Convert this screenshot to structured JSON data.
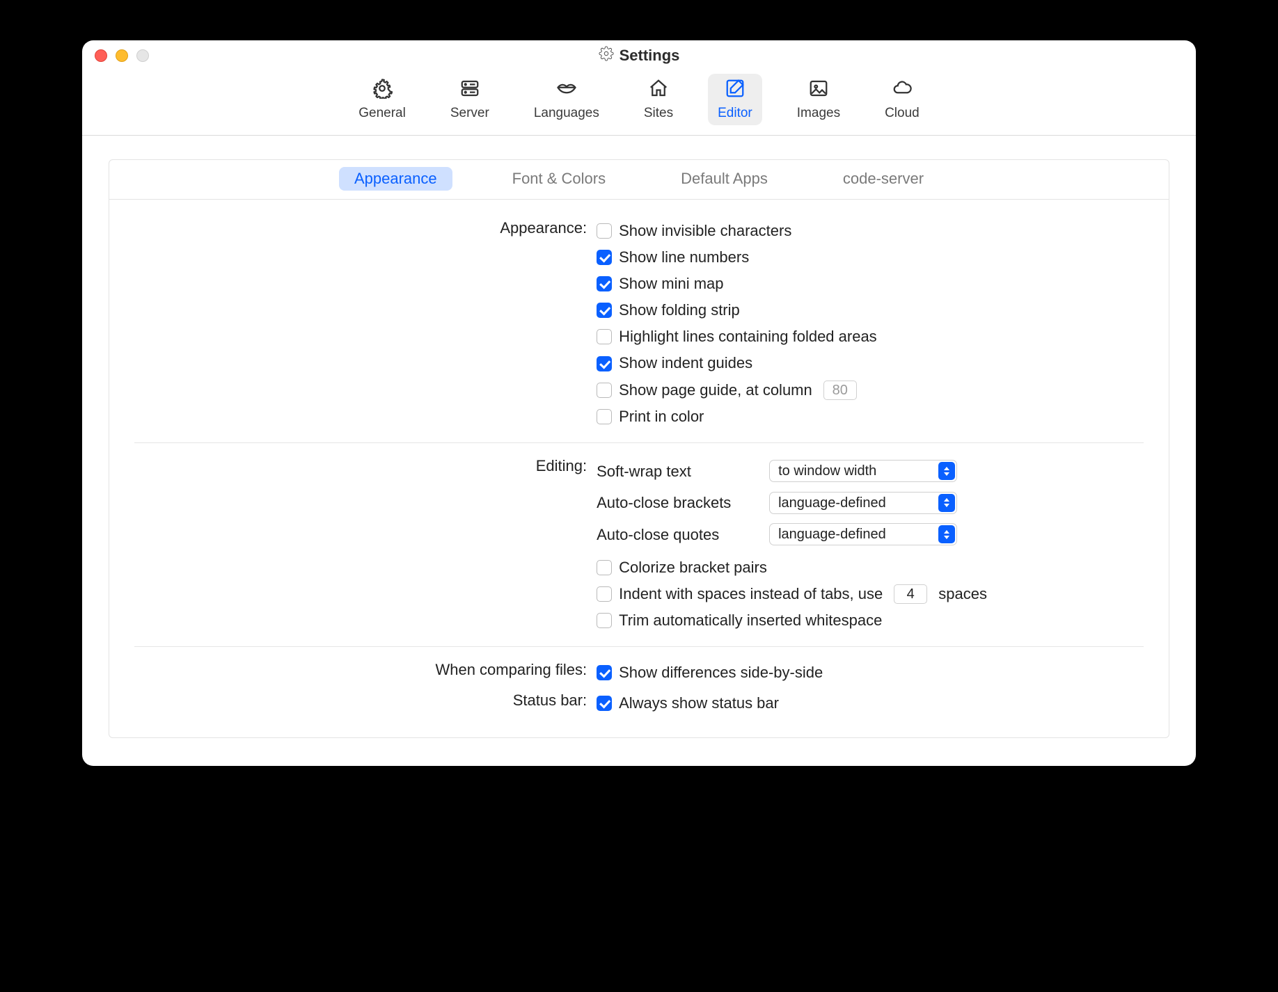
{
  "window": {
    "title": "Settings"
  },
  "toolbar": {
    "items": [
      {
        "label": "General"
      },
      {
        "label": "Server"
      },
      {
        "label": "Languages"
      },
      {
        "label": "Sites"
      },
      {
        "label": "Editor"
      },
      {
        "label": "Images"
      },
      {
        "label": "Cloud"
      }
    ],
    "active_index": 4
  },
  "segments": {
    "items": [
      "Appearance",
      "Font & Colors",
      "Default Apps",
      "code-server"
    ],
    "active_index": 0
  },
  "appearance": {
    "label": "Appearance:",
    "show_invisible": "Show invisible characters",
    "show_line_numbers": "Show line numbers",
    "show_minimap": "Show mini map",
    "show_folding_strip": "Show folding strip",
    "highlight_folded": "Highlight lines containing folded areas",
    "show_indent_guides": "Show indent guides",
    "show_page_guide": "Show page guide, at column",
    "page_guide_col": "80",
    "print_in_color": "Print in color"
  },
  "editing": {
    "label": "Editing:",
    "softwrap_label": "Soft-wrap text",
    "softwrap_value": "to window width",
    "autoclose_brackets_label": "Auto-close brackets",
    "autoclose_brackets_value": "language-defined",
    "autoclose_quotes_label": "Auto-close quotes",
    "autoclose_quotes_value": "language-defined",
    "colorize_brackets": "Colorize bracket pairs",
    "indent_spaces_label_pre": "Indent with spaces instead of tabs, use",
    "indent_spaces_value": "4",
    "indent_spaces_label_post": "spaces",
    "trim_whitespace": "Trim automatically inserted whitespace"
  },
  "compare": {
    "label": "When comparing files:",
    "side_by_side": "Show differences side-by-side"
  },
  "statusbar": {
    "label": "Status bar:",
    "always_show": "Always show status bar"
  }
}
